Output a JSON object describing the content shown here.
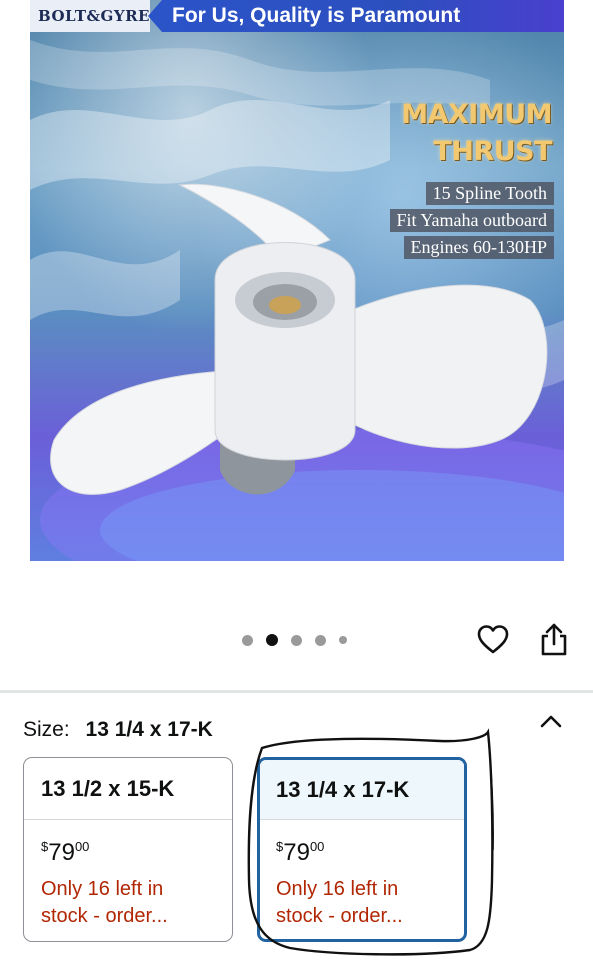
{
  "product_image": {
    "brand": "BOLT&GYRE",
    "slogan": "For Us, Quality is Paramount",
    "headline_line1": "MAXIMUM",
    "headline_line2": "THRUST",
    "specs": [
      "15 Spline Tooth",
      "Fit Yamaha outboard",
      "Engines 60-130HP"
    ]
  },
  "gallery": {
    "dot_count": 5,
    "active_index": 1
  },
  "actions": {
    "favorite_icon": "heart-icon",
    "share_icon": "share-icon"
  },
  "size_selector": {
    "label": "Size:",
    "selected_value": "13 1/4 x 17-K",
    "toggle_icon": "chevron-up-icon",
    "options": [
      {
        "name": "13 1/2 x 15-K",
        "price_symbol": "$",
        "price_whole": "79",
        "price_fraction": "00",
        "stock_line1": "Only 16 left in",
        "stock_line2": "stock - order...",
        "selected": false
      },
      {
        "name": "13 1/4 x 17-K",
        "price_symbol": "$",
        "price_whole": "79",
        "price_fraction": "00",
        "stock_line1": "Only 16 left in",
        "stock_line2": "stock - order...",
        "selected": true
      }
    ]
  },
  "colors": {
    "stock_text": "#b12704",
    "selected_border": "#2162a1",
    "selected_header_bg": "#edf7fc",
    "slogan_bg": "#2b54c9"
  }
}
